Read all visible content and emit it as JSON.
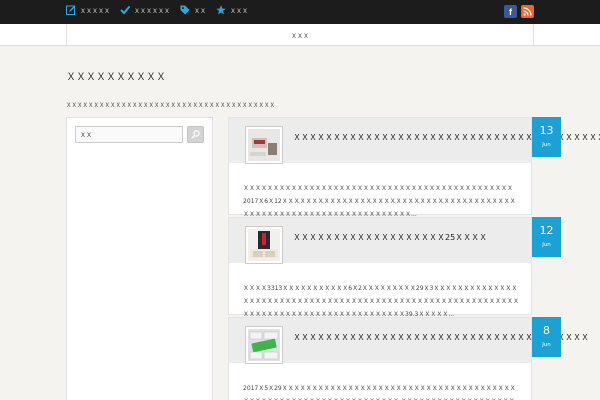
{
  "topnav": [
    {
      "label": "ＸＸＸＸＸ",
      "icon": "edit-icon"
    },
    {
      "label": "ＸＸＸＸＸＸ",
      "icon": "check-icon"
    },
    {
      "label": "ＸＸ",
      "icon": "tag-icon"
    },
    {
      "label": "ＸＸＸ",
      "icon": "star-icon"
    }
  ],
  "social": {
    "facebook": "f",
    "rss": "rss-icon"
  },
  "menu": {
    "home": "ＸＸＸ"
  },
  "page": {
    "title": "ＸＸＸＸＸＸＸＸＸＸ",
    "description": "ＸＸＸＸＸＸＸＸＸＸＸＸＸＸＸＸＸＸＸＸＸＸＸＸＸＸＸＸＸＸＸＸＸＸＸＸＸＸ"
  },
  "sidebar": {
    "search_value": "ＸＸ"
  },
  "posts": [
    {
      "title": "ＸＸＸＸＸＸＸＸＸＸＸＸＸＸＸＸＸＸＸＸＸＸＸＸＸＸＸＸＸＸＸＸＸＸＸＸＸＸＸＸＸ",
      "excerpt": "ＸＸＸＸＸＸＸＸＸＸＸＸＸＸＸＸＸＸＸＸＸＸＸＸＸＸＸＸＸＸＸＸＸＸＸＸＸＸＸＸＸＸＸＸＸ2017Ｘ6Ｘ12ＸＸＸＸＸＸＸＸＸＸＸＸＸＸＸＸＸＸＸＸＸＸＸＸＸＸＸＸＸＸＸＸＸＸＸＸＸＸＸＸＸＸＸＸＸＸＸＸＸＸＸＸＸＸＸＸＸＸＸＸＸＸＸＸＸＸＸ...",
      "day": "13",
      "month": "Jun"
    },
    {
      "title": "ＸＸＸＸＸＸＸＸＸＸＸＸＸＸＸＸＸＸＸ25ＸＸＸＸ",
      "excerpt": "ＸＸＸＸ3313ＸＸＸＸＸＸＸＸＸＸＸ6Ｘ2ＸＸＸＸＸＸＸＸＸ29Ｘ3ＸＸＸＸＸＸＸＸＸＸＸＸＸＸＸＸＸＸＸＸＸＸＸＸＸＸＸＸＸＸＸＸＸＸＸＸＸＸＸＸＸＸＸＸＸＸＸＸＸＸＸＸＸＸＸＸＸＸＸＸＸＸＸＸＸＸＸＸＸＸＸＸＸＸＸＸＸＸＸＸＸＸＸＸＸＸＸ39.3ＸＸＸＸＸ...",
      "day": "12",
      "month": "Jun"
    },
    {
      "title": "ＸＸＸＸＸＸＸＸＸＸＸＸＸＸＸＸＸＸＸＸＸＸＸＸＸＸＸＸＸＸＸＸＸＸＸＸＸ",
      "excerpt": "2017Ｘ5Ｘ29ＸＸＸＸＸＸＸＸＸＸＸＸＸＸＸＸＸＸＸＸＸＸＸＸＸＸＸＸＸＸＸＸＸＸＸＸＸＸＸＸＸＸＸＸＸＸＸＸＸＸＸＸＸＸＸＸＸＸＸＸＸＸＸＸＸ ＸＸＸＸＸＸＸＸＸＸＸＸＸＸＸＸＸＸＸ",
      "day": "8",
      "month": "Jun"
    }
  ]
}
